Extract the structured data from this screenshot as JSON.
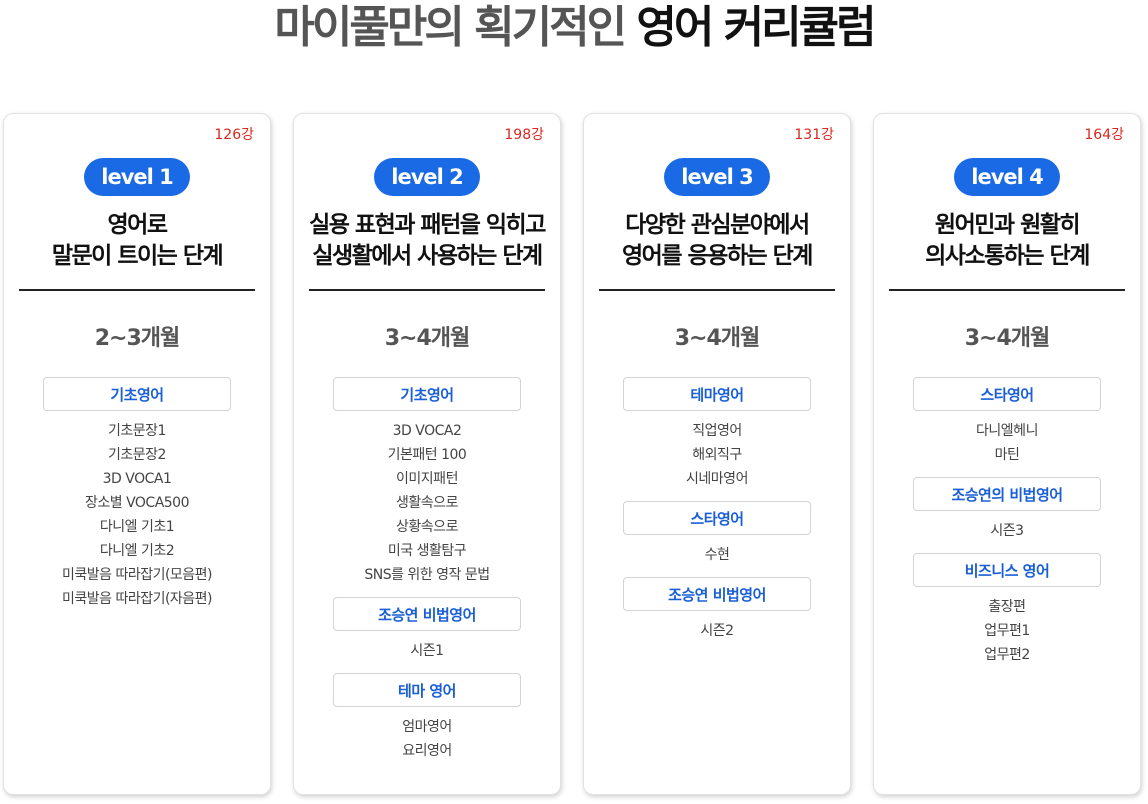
{
  "headline": {
    "part1": "마이풀만의 획기적인 ",
    "part2": "영어 커리큘럼"
  },
  "cards": [
    {
      "count": "126강",
      "level": "level 1",
      "title_line1": "영어로",
      "title_line2": "말문이 트이는 단계",
      "duration": "2~3개월",
      "sections": [
        {
          "heading": "기초영어",
          "items": [
            "기초문장1",
            "기초문장2",
            "3D VOCA1",
            "장소별 VOCA500",
            "다니엘 기초1",
            "다니엘 기초2",
            "미쿡발음 따라잡기(모음편)",
            "미쿡발음 따라잡기(자음편)"
          ]
        }
      ]
    },
    {
      "count": "198강",
      "level": "level 2",
      "title_line1": "실용 표현과 패턴을 익히고",
      "title_line2": "실생활에서 사용하는 단계",
      "duration": "3~4개월",
      "sections": [
        {
          "heading": "기초영어",
          "items": [
            "3D VOCA2",
            "기본패턴 100",
            "이미지패턴",
            "생활속으로",
            "상황속으로",
            "미국 생활탐구",
            "SNS를 위한 영작 문법"
          ]
        },
        {
          "heading": "조승연 비법영어",
          "items": [
            "시즌1"
          ]
        },
        {
          "heading": "테마 영어",
          "items": [
            "엄마영어",
            "요리영어"
          ]
        }
      ]
    },
    {
      "count": "131강",
      "level": "level 3",
      "title_line1": "다양한 관심분야에서",
      "title_line2": "영어를 응용하는 단계",
      "duration": "3~4개월",
      "sections": [
        {
          "heading": "테마영어",
          "items": [
            "직업영어",
            "해외직구",
            "시네마영어"
          ]
        },
        {
          "heading": "스타영어",
          "items": [
            "수현"
          ]
        },
        {
          "heading": "조승연 비법영어",
          "items": [
            "시즌2"
          ]
        }
      ]
    },
    {
      "count": "164강",
      "level": "level 4",
      "title_line1": "원어민과 원활히",
      "title_line2": "의사소통하는 단계",
      "duration": "3~4개월",
      "sections": [
        {
          "heading": "스타영어",
          "items": [
            "다니엘헤니",
            "마틴"
          ]
        },
        {
          "heading": "조승연의 비법영어",
          "items": [
            "시즌3"
          ]
        },
        {
          "heading": "비즈니스 영어",
          "items": [
            "출장편",
            "업무편1",
            "업무편2"
          ]
        }
      ]
    }
  ],
  "colors": {
    "accent": "#1a6ae6",
    "count": "#d9271f",
    "section_text": "#1a5fd6"
  }
}
